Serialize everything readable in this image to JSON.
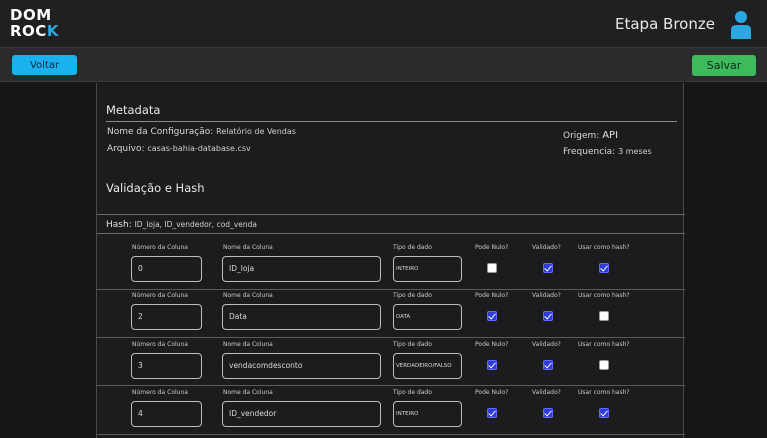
{
  "header": {
    "logo_line1": "DOM",
    "logo_line2_main": "ROC",
    "logo_line2_accent": "K",
    "stage_title": "Etapa Bronze",
    "user_icon": "user-icon"
  },
  "toolbar": {
    "back_label": "Voltar",
    "save_label": "Salvar",
    "back_color": "#1ab2ee",
    "save_color": "#3dba5c"
  },
  "metadata": {
    "section_title": "Metadata",
    "config_label": "Nome da Configuração:",
    "config_value": "Relatório de Vendas",
    "file_label": "Arquivo:",
    "file_value": "casas-bahia-database.csv",
    "origin_label": "Origem:",
    "origin_value": "API",
    "frequency_label": "Frequencia:",
    "frequency_value": "3 meses"
  },
  "validation": {
    "section_title": "Validação e Hash",
    "hash_label": "Hash:",
    "hash_value": "ID_loja, ID_vendedor, cod_venda"
  },
  "columns_labels": {
    "number": "Número da Coluna",
    "name": "Nome da Coluna",
    "type": "Tipo de dado",
    "nullable": "Pode Nulo?",
    "validated": "Validado?",
    "use_hash": "Usar como hash?"
  },
  "rows": [
    {
      "number": "0",
      "name": "ID_loja",
      "type": "INTEIRO",
      "nullable": false,
      "validated": true,
      "use_hash": true
    },
    {
      "number": "2",
      "name": "Data",
      "type": "DATA",
      "nullable": true,
      "validated": true,
      "use_hash": false
    },
    {
      "number": "3",
      "name": "vendacomdesconto",
      "type": "VERDADEIRO/FALSO",
      "nullable": true,
      "validated": true,
      "use_hash": false
    },
    {
      "number": "4",
      "name": "ID_vendedor",
      "type": "INTEIRO",
      "nullable": true,
      "validated": true,
      "use_hash": true
    }
  ]
}
